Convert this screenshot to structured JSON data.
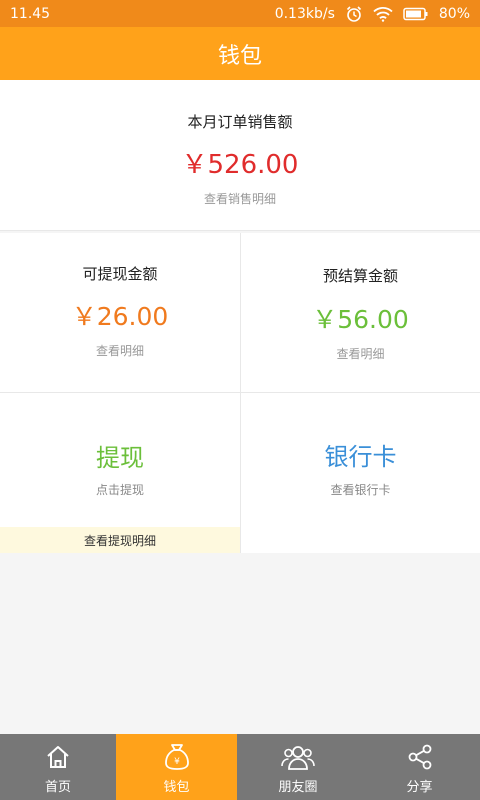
{
  "status": {
    "time": "11.45",
    "speed": "0.13kb/s",
    "battery": "80%"
  },
  "header": {
    "title": "钱包"
  },
  "sales": {
    "label": "本月订单销售额",
    "amount": "￥526.00",
    "link": "查看销售明细",
    "color": "#e02c2c"
  },
  "withdrawable": {
    "label": "可提现金额",
    "amount": "￥26.00",
    "link": "查看明细",
    "color": "#f07a1e"
  },
  "pending": {
    "label": "预结算金额",
    "amount": "￥56.00",
    "link": "查看明细",
    "color": "#6bbf3a"
  },
  "withdraw": {
    "title": "提现",
    "sub": "点击提现",
    "detail": "查看提现明细",
    "color": "#6bbf3a"
  },
  "bankcard": {
    "title": "银行卡",
    "sub": "查看银行卡",
    "color": "#3a8fd8"
  },
  "tabs": [
    {
      "label": "首页",
      "icon": "home-icon"
    },
    {
      "label": "钱包",
      "icon": "wallet-icon"
    },
    {
      "label": "朋友圈",
      "icon": "friends-icon"
    },
    {
      "label": "分享",
      "icon": "share-icon"
    }
  ],
  "colors": {
    "status_bar": "#f08a1a",
    "header": "#ffa21a",
    "tab_bar": "#777777",
    "tab_active": "#ffa21a"
  }
}
